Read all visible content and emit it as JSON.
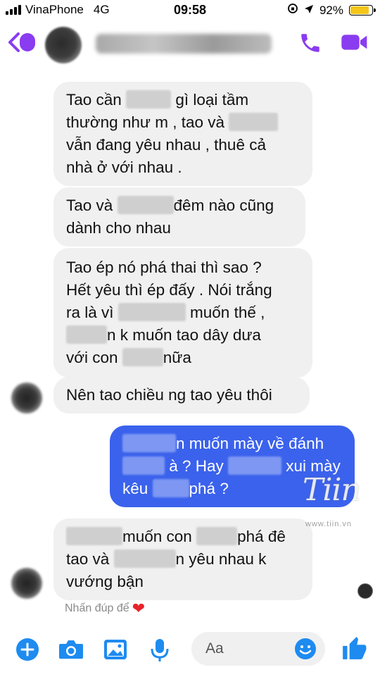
{
  "status_bar": {
    "carrier": "VinaPhone",
    "network": "4G",
    "time": "09:58",
    "battery": "92%"
  },
  "messages": [
    {
      "side": "in",
      "lines": [
        [
          {
            "t": "Tao cần "
          },
          {
            "b": 64
          },
          {
            "t": " gì loại tầm"
          }
        ],
        [
          {
            "t": "thường như m , tao và "
          },
          {
            "b": 70
          }
        ],
        [
          {
            "t": "vẫn đang yêu nhau , thuê cả"
          }
        ],
        [
          {
            "t": "nhà ở với nhau ."
          }
        ]
      ]
    },
    {
      "side": "in",
      "lines": [
        [
          {
            "t": "Tao và "
          },
          {
            "b": 80
          },
          {
            "t": "đêm nào cũng"
          }
        ],
        [
          {
            "t": "dành cho nhau"
          }
        ]
      ]
    },
    {
      "side": "in",
      "lines": [
        [
          {
            "t": "Tao ép nó phá thai thì sao ?"
          }
        ],
        [
          {
            "t": "Hết yêu thì ép đấy . Nói trắng"
          }
        ],
        [
          {
            "t": "ra là vì "
          },
          {
            "b": 96
          },
          {
            "t": " muốn thế ,"
          }
        ],
        [
          {
            "b": 58
          },
          {
            "t": "n k muốn tao dây dưa"
          }
        ],
        [
          {
            "t": "với con "
          },
          {
            "b": 58
          },
          {
            "t": "nữa"
          }
        ]
      ]
    },
    {
      "side": "in",
      "lines": [
        [
          {
            "t": "Nên tao chiều ng tao yêu thôi"
          }
        ]
      ]
    },
    {
      "side": "out",
      "lines": [
        [
          {
            "b": 76
          },
          {
            "t": "n muốn mày về đánh"
          }
        ],
        [
          {
            "b": 60
          },
          {
            "t": " à ? Hay "
          },
          {
            "b": 76
          },
          {
            "t": " xui mày"
          }
        ],
        [
          {
            "t": "kêu "
          },
          {
            "b": 52
          },
          {
            "t": "phá ?"
          }
        ]
      ]
    },
    {
      "side": "in",
      "lines": [
        [
          {
            "b": 80
          },
          {
            "t": "muốn con "
          },
          {
            "b": 58
          },
          {
            "t": "phá đê"
          }
        ],
        [
          {
            "t": "tao và "
          },
          {
            "b": 88
          },
          {
            "t": "n yêu nhau k"
          }
        ],
        [
          {
            "t": "vướng bận"
          }
        ]
      ]
    }
  ],
  "hint": {
    "text": "Nhấn đúp để",
    "icon": "heart-icon"
  },
  "watermark": {
    "text": "Tiin",
    "url": "www.tiin.vn"
  },
  "composer": {
    "placeholder": "Aa"
  },
  "colors": {
    "accent": "#8a3cf0",
    "outgoing_bubble": "#3b62ec",
    "incoming_bubble": "#f0f0f0",
    "messenger_blue": "#1e8bf0"
  },
  "icons": [
    "back-chevron-icon",
    "phone-icon",
    "video-camera-icon",
    "plus-icon",
    "camera-icon",
    "gallery-icon",
    "microphone-icon",
    "emoji-icon",
    "thumbs-up-icon"
  ]
}
